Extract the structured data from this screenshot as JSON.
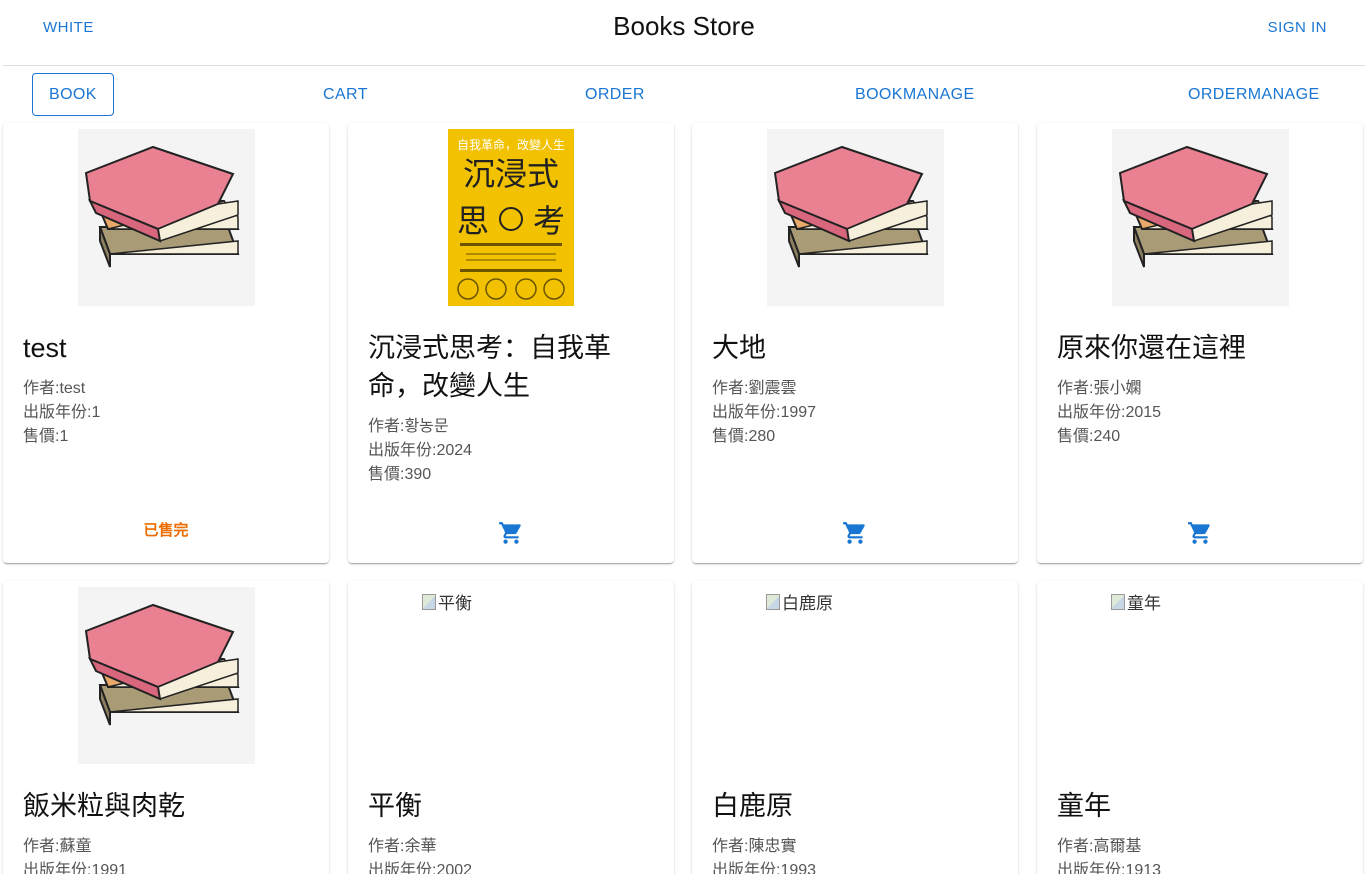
{
  "header": {
    "left_button": "WHITE",
    "title": "Books Store",
    "right_button": "SIGN IN"
  },
  "nav": {
    "tabs": [
      {
        "label": "BOOK",
        "active": true
      },
      {
        "label": "CART"
      },
      {
        "label": "ORDER"
      },
      {
        "label": "BOOKMANAGE"
      },
      {
        "label": "ORDERMANAGE"
      }
    ]
  },
  "colors": {
    "accent": "#1976d2",
    "soldout": "#ed6c02",
    "cover_yellow": "#f2c200"
  },
  "books": [
    {
      "name": "test",
      "author": "作者:test",
      "year": "出版年份:1",
      "price": "售價:1",
      "status": "已售完",
      "image": "books-stack"
    },
    {
      "name": "沉浸式思考：自我革命，改變人生",
      "author": "作者:황농문",
      "year": "出版年份:2024",
      "price": "售價:390",
      "status": "cart-icon",
      "image": "yellow-cover",
      "cover": {
        "top": "自我革命，改變人生",
        "line1": "沉浸式",
        "line2a": "思",
        "line2b": "考"
      }
    },
    {
      "name": "大地",
      "author": "作者:劉震雲",
      "year": "出版年份:1997",
      "price": "售價:280",
      "status": "cart-icon",
      "image": "books-stack"
    },
    {
      "name": "原來你還在這裡",
      "author": "作者:張小嫻",
      "year": "出版年份:2015",
      "price": "售價:240",
      "status": "cart-icon",
      "image": "books-stack"
    },
    {
      "name": "飯米粒與肉乾",
      "author": "作者:蘇童",
      "year": "出版年份:1991",
      "image": "books-stack"
    },
    {
      "name": "平衡",
      "author": "作者:余華",
      "year": "出版年份:2002",
      "image": "broken",
      "alt": "平衡"
    },
    {
      "name": "白鹿原",
      "author": "作者:陳忠實",
      "year": "出版年份:1993",
      "image": "broken",
      "alt": "白鹿原"
    },
    {
      "name": "童年",
      "author": "作者:高爾基",
      "year": "出版年份:1913",
      "image": "broken",
      "alt": "童年"
    }
  ]
}
